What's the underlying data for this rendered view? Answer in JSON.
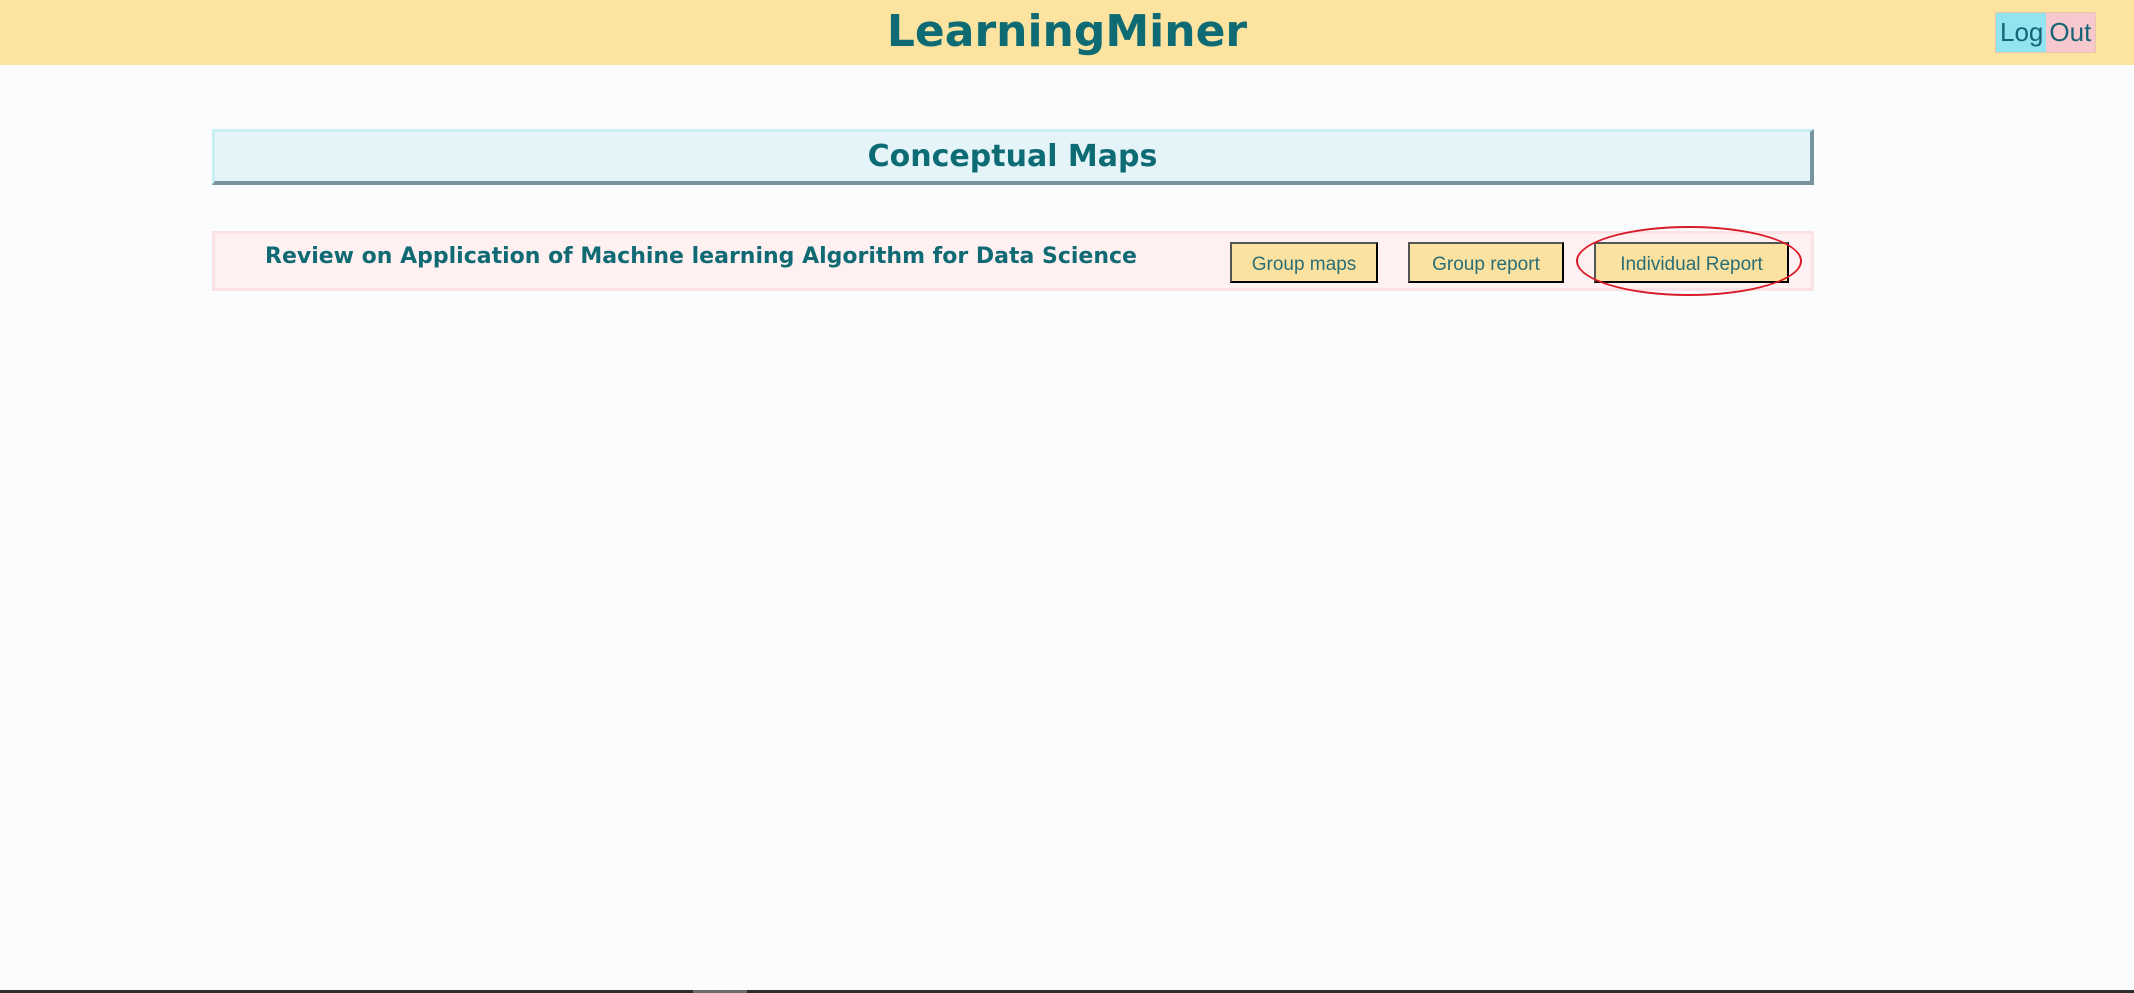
{
  "header": {
    "brand": "LearningMiner",
    "logout": {
      "part1": "Log",
      "part2": "Out"
    }
  },
  "main": {
    "section_title": "Conceptual Maps",
    "maps": [
      {
        "title": "Review on Application of Machine learning Algorithm for Data Science",
        "buttons": {
          "group_maps": "Group maps",
          "group_report": "Group report",
          "individual_report": "Individual Report"
        }
      }
    ]
  },
  "colors": {
    "header_bg": "#fce3a0",
    "accent_text": "#0f6b73",
    "section_title_bg": "#e4f4f8",
    "row_bg": "#fff0f1",
    "button_bg": "#fbe2a0",
    "logout_left_bg": "#90e5f1",
    "logout_right_bg": "#f8c8cf",
    "highlight_ring": "#d81c28"
  }
}
